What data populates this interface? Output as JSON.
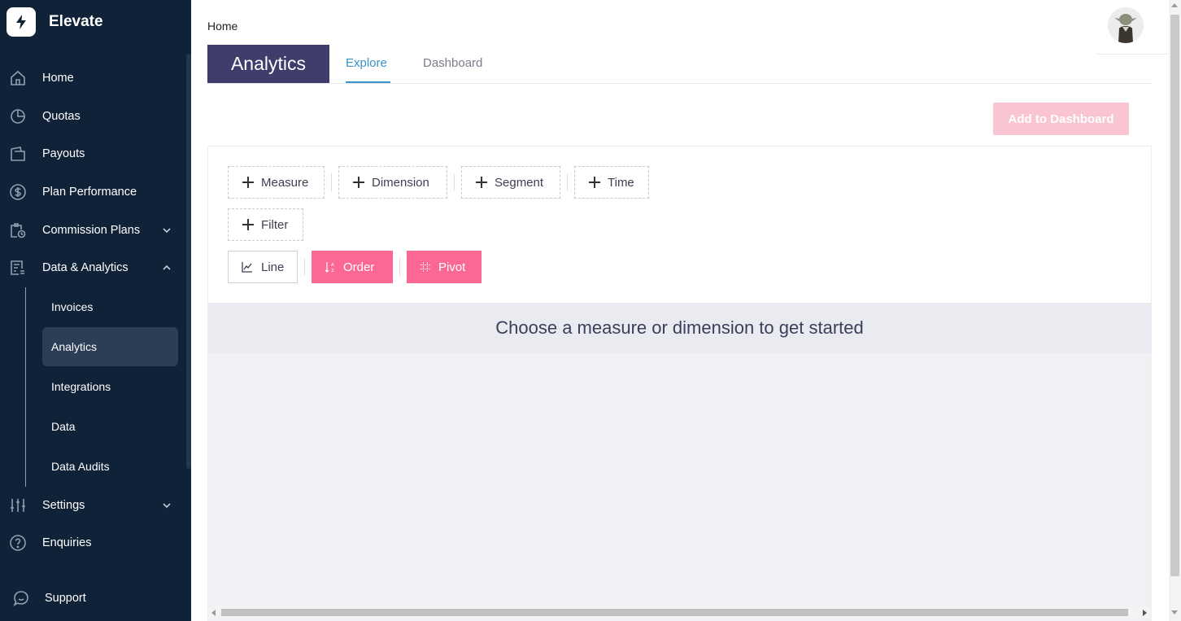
{
  "brand": {
    "name": "Elevate",
    "icon": "lightning-bolt-icon"
  },
  "sidebar": {
    "items": [
      {
        "label": "Home",
        "icon": "home-icon"
      },
      {
        "label": "Quotas",
        "icon": "pie-chart-icon"
      },
      {
        "label": "Payouts",
        "icon": "wallet-icon"
      },
      {
        "label": "Plan Performance",
        "icon": "dollar-circle-icon"
      },
      {
        "label": "Commission Plans",
        "icon": "clipboard-clock-icon",
        "expandable": true
      },
      {
        "label": "Data & Analytics",
        "icon": "report-icon",
        "expanded": true
      },
      {
        "label": "Settings",
        "icon": "sliders-icon",
        "expandable": true
      },
      {
        "label": "Enquiries",
        "icon": "question-circle-icon"
      },
      {
        "label": "Support",
        "icon": "chat-bubble-icon"
      }
    ],
    "sub_items": [
      {
        "label": "Invoices"
      },
      {
        "label": "Analytics",
        "active": true
      },
      {
        "label": "Integrations"
      },
      {
        "label": "Data"
      },
      {
        "label": "Data Audits"
      }
    ]
  },
  "header": {
    "breadcrumb": "Home",
    "avatar": "user-avatar"
  },
  "page": {
    "title": "Analytics",
    "tabs": [
      {
        "label": "Explore",
        "active": true
      },
      {
        "label": "Dashboard",
        "active": false
      }
    ],
    "add_button": "Add to Dashboard"
  },
  "query_builder": {
    "members": [
      {
        "label": "Measure"
      },
      {
        "label": "Dimension"
      },
      {
        "label": "Segment"
      },
      {
        "label": "Time"
      }
    ],
    "filter": {
      "label": "Filter"
    },
    "chart_type": {
      "label": "Line",
      "icon": "line-chart-icon"
    },
    "order": {
      "label": "Order",
      "icon": "sort-az-icon"
    },
    "pivot": {
      "label": "Pivot",
      "icon": "grid-icon"
    }
  },
  "empty_state": "Choose a measure or dimension to get started",
  "colors": {
    "sidebar_bg": "#0f2238",
    "active_sub_bg": "#2b3e56",
    "title_block": "#3e3d6b",
    "accent_blue": "#3a91c9",
    "pink": "#fb6893",
    "pink_disabled": "#f9c5d3"
  }
}
